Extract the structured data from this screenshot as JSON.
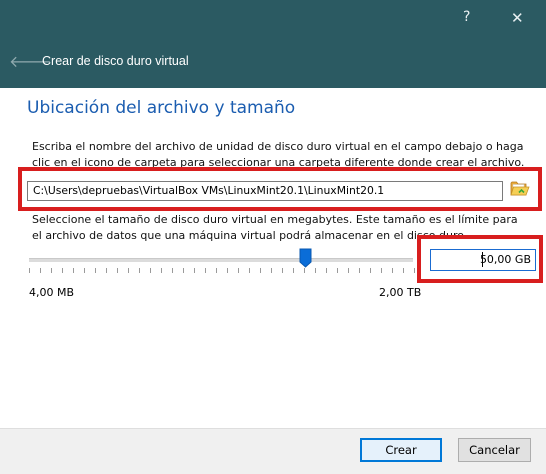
{
  "window": {
    "title": "Crear de disco duro virtual",
    "help_label": "?",
    "close_label": "✕",
    "back_label": "🡐"
  },
  "page": {
    "heading": "Ubicación del archivo y tamaño",
    "instruction_file": "Escriba el nombre del archivo de unidad de disco duro virtual en el campo debajo o haga clic en el icono de carpeta para seleccionar una carpeta diferente donde crear el archivo.",
    "file_path": "C:\\Users\\depruebas\\VirtualBox VMs\\LinuxMint20.1\\LinuxMint20.1",
    "instruction_size": "Seleccione el tamaño de disco duro virtual en megabytes. Este tamaño es el límite para el archivo de datos que una máquina virtual podrá almacenar en el disco duro.",
    "slider": {
      "min_label": "4,00 MB",
      "max_label": "2,00 TB",
      "position_fraction": 0.72
    },
    "size_value": "50,00 GB"
  },
  "footer": {
    "create_label": "Crear",
    "cancel_label": "Cancelar"
  },
  "colors": {
    "header_bg": "#2b5a62",
    "heading": "#1b5db0",
    "highlight": "#d81e1e",
    "focus": "#0078d7"
  },
  "icons": {
    "folder": "folder-open-icon",
    "back": "back-arrow-icon",
    "help": "help-icon",
    "close": "close-icon",
    "slider_thumb": "slider-thumb"
  }
}
